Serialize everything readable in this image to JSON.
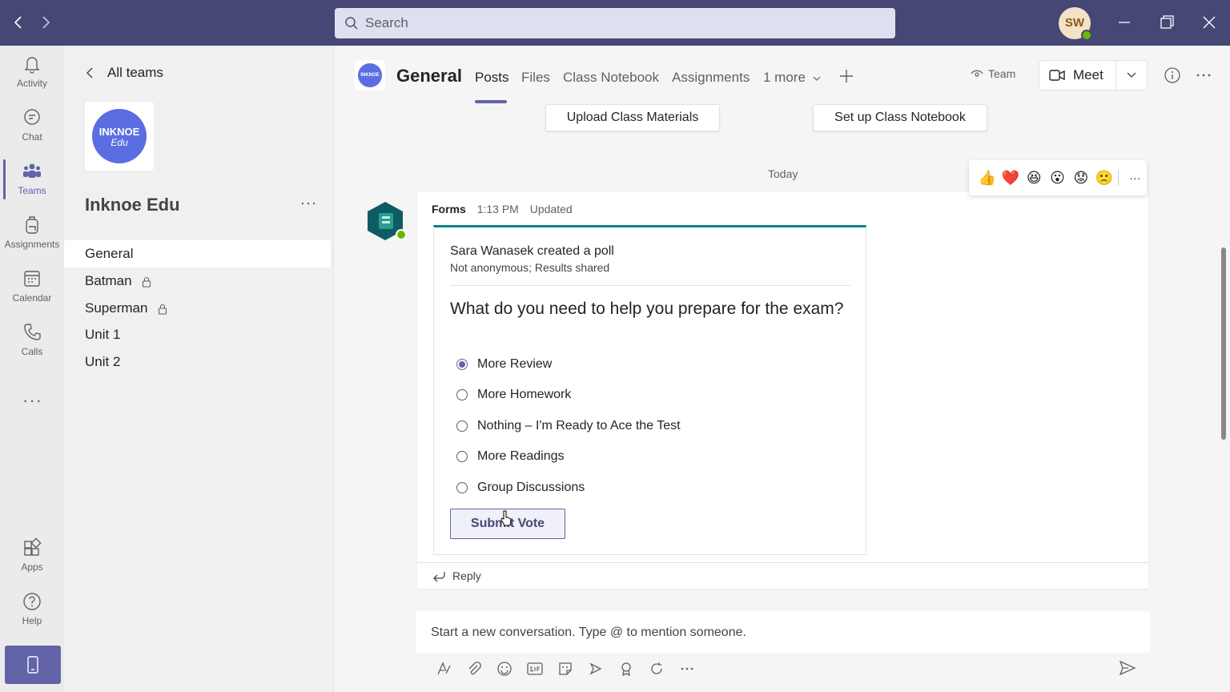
{
  "titlebar": {
    "search_placeholder": "Search",
    "avatar_initials": "SW",
    "accent": "#464775"
  },
  "rail": {
    "items": [
      {
        "label": "Activity",
        "icon": "bell-icon"
      },
      {
        "label": "Chat",
        "icon": "chat-icon"
      },
      {
        "label": "Teams",
        "icon": "teams-icon"
      },
      {
        "label": "Assignments",
        "icon": "backpack-icon"
      },
      {
        "label": "Calendar",
        "icon": "calendar-icon"
      },
      {
        "label": "Calls",
        "icon": "phone-icon"
      }
    ],
    "more": "···",
    "bottom": [
      {
        "label": "Apps",
        "icon": "apps-icon"
      },
      {
        "label": "Help",
        "icon": "help-icon"
      }
    ],
    "active": "Teams"
  },
  "teampanel": {
    "back_label": "All teams",
    "logo_line1": "INKNOE",
    "logo_line2": "Edu",
    "team_name": "Inknoe Edu",
    "more": "···",
    "channels": [
      {
        "name": "General",
        "private": false
      },
      {
        "name": "Batman",
        "private": true
      },
      {
        "name": "Superman",
        "private": true
      },
      {
        "name": "Unit 1",
        "private": false
      },
      {
        "name": "Unit 2",
        "private": false
      }
    ],
    "active_channel": "General"
  },
  "header": {
    "channel_logo_text": "INKNOE",
    "channel_title": "General",
    "tabs": [
      "Posts",
      "Files",
      "Class Notebook",
      "Assignments",
      "1 more"
    ],
    "active_tab": "Posts",
    "team_badge": "Team",
    "meet_label": "Meet"
  },
  "pinned": {
    "upload": "Upload Class Materials",
    "notebook": "Set up Class Notebook"
  },
  "feed": {
    "date_divider": "Today",
    "reactions": [
      "👍",
      "❤️",
      "😆",
      "😮",
      "😟",
      "🙁"
    ],
    "reactions_more": "···"
  },
  "post": {
    "sender": "Forms",
    "time": "1:13 PM",
    "status": "Updated",
    "card": {
      "creator": "Sara Wanasek created a poll",
      "sub": "Not anonymous; Results shared",
      "question": "What do you need to help you prepare for the exam?",
      "options": [
        "More Review",
        "More Homework",
        "Nothing – I'm Ready to Ace the Test",
        "More Readings",
        "Group Discussions"
      ],
      "selected": "More Review",
      "submit_label": "Submit Vote"
    },
    "reply_label": "Reply"
  },
  "composer": {
    "placeholder": "Start a new conversation. Type @ to mention someone."
  }
}
